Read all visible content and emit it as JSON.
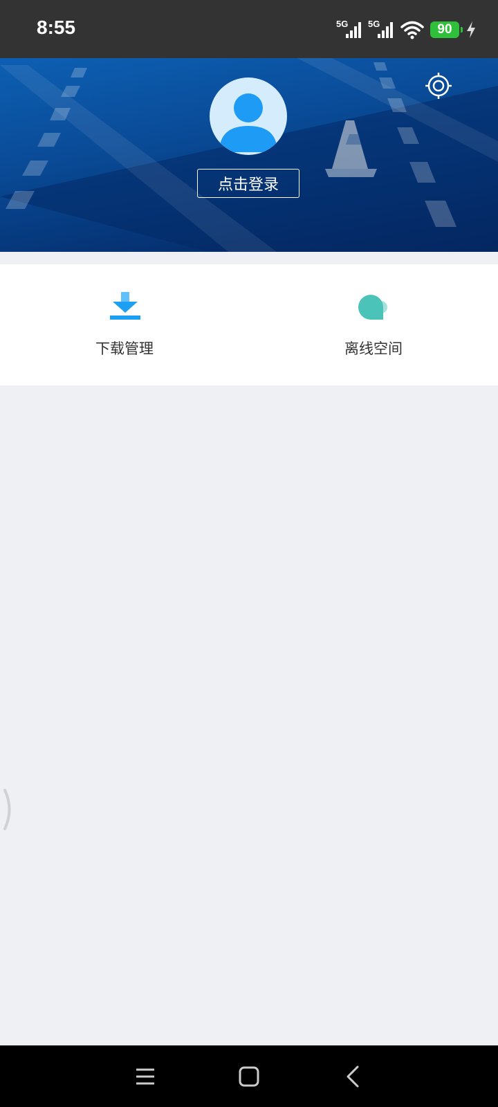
{
  "status_bar": {
    "time": "8:55",
    "network_1": "5G",
    "network_2": "5G",
    "battery_level": "90",
    "icons": [
      "signal-icon",
      "signal-icon",
      "wifi-icon",
      "battery-icon",
      "charging-icon"
    ]
  },
  "header": {
    "login_label": "点击登录",
    "avatar_icon": "user-avatar-icon",
    "settings_icon": "settings-icon"
  },
  "quick_actions": [
    {
      "label": "下载管理",
      "icon": "download-icon",
      "color": "#1ea0f2"
    },
    {
      "label": "离线空间",
      "icon": "cloud-icon",
      "color": "#4cc3b8"
    }
  ],
  "nav_bar": {
    "icons": [
      "menu-icon",
      "home-icon",
      "back-icon"
    ]
  },
  "colors": {
    "banner_primary": "#0a4d9a",
    "avatar_fill": "#1e9bf5",
    "page_background": "#eef0f3"
  }
}
